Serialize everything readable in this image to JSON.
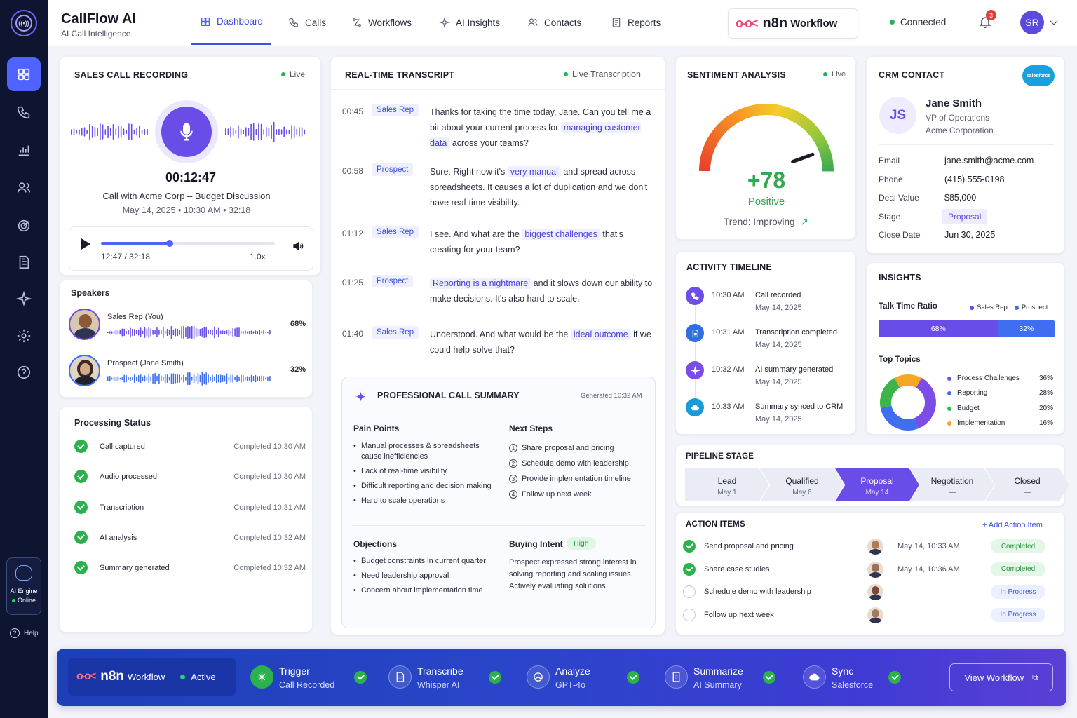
{
  "brand": {
    "name": "CallFlow AI",
    "tagline": "AI Call Intelligence"
  },
  "nav": [
    {
      "label": "Dashboard",
      "icon": "grid-icon",
      "active": true
    },
    {
      "label": "Calls",
      "icon": "phone-icon"
    },
    {
      "label": "Workflows",
      "icon": "workflow-icon"
    },
    {
      "label": "AI Insights",
      "icon": "sparkle-icon"
    },
    {
      "label": "Contacts",
      "icon": "users-icon"
    },
    {
      "label": "Reports",
      "icon": "report-icon"
    }
  ],
  "header": {
    "n8n_logo": "n8n",
    "n8n_label": "Workflow",
    "connection_status": "Connected",
    "notification_count": "3",
    "avatar_initials": "SR"
  },
  "sidebar": {
    "engine_title": "AI Engine",
    "engine_status": "Online",
    "help_label": "Help"
  },
  "recording": {
    "title": "SALES CALL RECORDING",
    "live_label": "Live",
    "elapsed": "00:12:47",
    "call_name": "Call with Acme Corp – Budget Discussion",
    "call_meta": "May 14, 2025 • 10:30 AM • 32:18",
    "player_time": "12:47 / 32:18",
    "speed": "1.0x",
    "progress_fraction": 0.396
  },
  "speakers": {
    "title": "Speakers",
    "items": [
      {
        "name": "Sales Rep (You)",
        "percent": "68%"
      },
      {
        "name": "Prospect (Jane Smith)",
        "percent": "32%"
      }
    ]
  },
  "processing": {
    "title": "Processing Status",
    "items": [
      {
        "label": "Call captured",
        "status": "Completed 10:30 AM"
      },
      {
        "label": "Audio processed",
        "status": "Completed 10:30 AM"
      },
      {
        "label": "Transcription",
        "status": "Completed 10:31 AM"
      },
      {
        "label": "AI analysis",
        "status": "Completed 10:32 AM"
      },
      {
        "label": "Summary generated",
        "status": "Completed 10:32 AM"
      }
    ]
  },
  "transcript": {
    "title": "REAL-TIME TRANSCRIPT",
    "live_label": "Live Transcription",
    "entries": [
      {
        "time": "00:45",
        "speaker": "Sales Rep",
        "parts": [
          "Thanks for taking the time today, Jane. Can you tell me a bit about your current process for ",
          "managing customer data",
          " across your teams?"
        ]
      },
      {
        "time": "00:58",
        "speaker": "Prospect",
        "parts": [
          "Sure. Right now it's ",
          "very manual",
          " and spread across spreadsheets. It causes a lot of duplication and we don't have real-time visibility."
        ]
      },
      {
        "time": "01:12",
        "speaker": "Sales Rep",
        "parts": [
          "I see. And what are the ",
          "biggest challenges",
          " that's creating for your team?"
        ]
      },
      {
        "time": "01:25",
        "speaker": "Prospect",
        "parts": [
          "",
          "Reporting is a nightmare",
          " and it slows down our ability to make decisions. It's also hard to scale."
        ]
      },
      {
        "time": "01:40",
        "speaker": "Sales Rep",
        "parts": [
          "Understood. And what would be the ",
          "ideal outcome",
          " if we could help solve that?"
        ]
      }
    ]
  },
  "summary": {
    "title": "PROFESSIONAL CALL SUMMARY",
    "generated": "Generated 10:32 AM",
    "pain_points_title": "Pain Points",
    "pain_points": [
      "Manual processes & spreadsheets cause inefficiencies",
      "Lack of real-time visibility",
      "Difficult reporting and decision making",
      "Hard to scale operations"
    ],
    "next_steps_title": "Next Steps",
    "next_steps": [
      "Share proposal and pricing",
      "Schedule demo with leadership",
      "Provide implementation timeline",
      "Follow up next week"
    ],
    "objections_title": "Objections",
    "objections": [
      "Budget constraints in current quarter",
      "Need leadership approval",
      "Concern about implementation time"
    ],
    "buying_intent_title": "Buying Intent",
    "buying_intent_level": "High",
    "buying_intent_text": "Prospect expressed strong interest in solving reporting and scaling issues. Actively evaluating solutions."
  },
  "sentiment": {
    "title": "SENTIMENT ANALYSIS",
    "live_label": "Live",
    "score": "+78",
    "label": "Positive",
    "trend": "Trend: Improving",
    "gauge_fraction": 0.89
  },
  "crm": {
    "title": "CRM CONTACT",
    "logo_text": "salesforce",
    "initials": "JS",
    "name": "Jane Smith",
    "role": "VP of Operations",
    "company": "Acme Corporation",
    "fields": [
      {
        "label": "Email",
        "value": "jane.smith@acme.com"
      },
      {
        "label": "Phone",
        "value": "(415) 555-0198"
      },
      {
        "label": "Deal Value",
        "value": "$85,000"
      },
      {
        "label": "Stage",
        "value": "Proposal"
      },
      {
        "label": "Close Date",
        "value": "Jun 30, 2025"
      }
    ]
  },
  "timeline": {
    "title": "ACTIVITY TIMELINE",
    "items": [
      {
        "time": "10:30 AM",
        "event": "Call recorded",
        "date": "May 14, 2025",
        "icon": "phone-icon",
        "color": "#6b4fe8"
      },
      {
        "time": "10:31 AM",
        "event": "Transcription completed",
        "date": "May 14, 2025",
        "icon": "document-icon",
        "color": "#2f6fe0"
      },
      {
        "time": "10:32 AM",
        "event": "AI summary generated",
        "date": "May 14, 2025",
        "icon": "sparkle-icon",
        "color": "#7b4ce6"
      },
      {
        "time": "10:33 AM",
        "event": "Summary synced to CRM",
        "date": "May 14, 2025",
        "icon": "cloud-icon",
        "color": "#1a9ad6"
      }
    ]
  },
  "insights": {
    "title": "INSIGHTS",
    "talk_title": "Talk Time Ratio",
    "legend_rep": "Sales Rep",
    "legend_prospect": "Prospect",
    "rep_pct": "68%",
    "prospect_pct": "32%",
    "rep_fraction": 0.68,
    "topics_title": "Top Topics",
    "topics": [
      {
        "name": "Process Challenges",
        "pct": "36%",
        "value": 36,
        "color": "#7b4ce6"
      },
      {
        "name": "Reporting",
        "pct": "28%",
        "value": 28,
        "color": "#3f6ff0"
      },
      {
        "name": "Budget",
        "pct": "20%",
        "value": 20,
        "color": "#3bb54a"
      },
      {
        "name": "Implementation",
        "pct": "16%",
        "value": 16,
        "color": "#f5a623"
      }
    ]
  },
  "pipeline": {
    "title": "PIPELINE STAGE",
    "stages": [
      {
        "name": "Lead",
        "date": "May 1"
      },
      {
        "name": "Qualified",
        "date": "May 6"
      },
      {
        "name": "Proposal",
        "date": "May 14",
        "active": true
      },
      {
        "name": "Negotiation",
        "date": "—"
      },
      {
        "name": "Closed",
        "date": "—"
      }
    ]
  },
  "actions": {
    "title": "ACTION ITEMS",
    "add_label": "+ Add Action Item",
    "items": [
      {
        "label": "Send proposal and pricing",
        "date": "May 14, 10:33 AM",
        "status": "Completed",
        "done": true
      },
      {
        "label": "Share case studies",
        "date": "May 14, 10:36 AM",
        "status": "Completed",
        "done": true
      },
      {
        "label": "Schedule demo with leadership",
        "date": "",
        "status": "In Progress",
        "done": false
      },
      {
        "label": "Follow up next week",
        "date": "",
        "status": "In Progress",
        "done": false
      }
    ]
  },
  "workflow": {
    "logo": "n8n",
    "label": "Workflow",
    "status": "Active",
    "steps": [
      {
        "title": "Trigger",
        "sub": "Call Recorded",
        "icon": "trigger-icon"
      },
      {
        "title": "Transcribe",
        "sub": "Whisper AI",
        "icon": "document-icon"
      },
      {
        "title": "Analyze",
        "sub": "GPT-4o",
        "icon": "openai-icon"
      },
      {
        "title": "Summarize",
        "sub": "AI Summary",
        "icon": "summary-icon"
      },
      {
        "title": "Sync",
        "sub": "Salesforce",
        "icon": "cloud-icon"
      }
    ],
    "view_button": "View Workflow"
  }
}
